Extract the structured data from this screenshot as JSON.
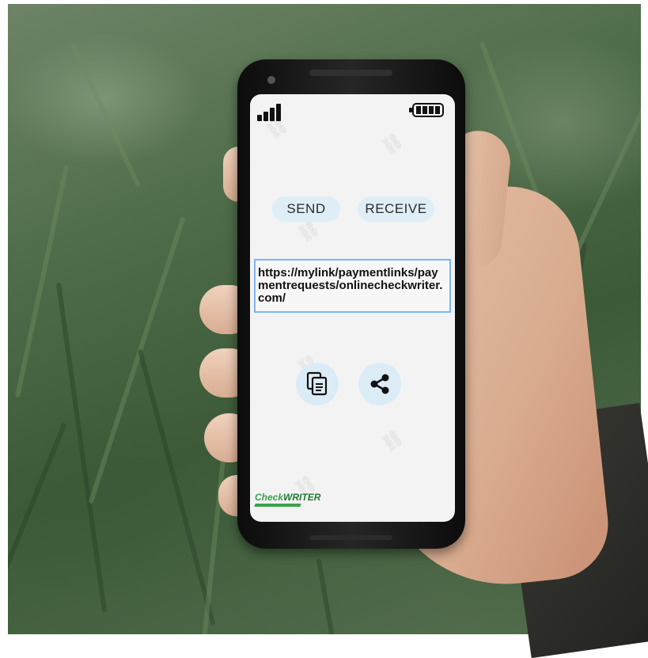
{
  "app": {
    "buttons": {
      "send_label": "SEND",
      "receive_label": "RECEIVE"
    },
    "payment_link": "https://mylink/paymentlinks/paymentrequests/onlinecheckwriter.com/",
    "actions": {
      "copy_icon": "copy-icon",
      "share_icon": "share-icon"
    },
    "status_bar": {
      "signal_icon": "signal-icon",
      "battery_icon": "battery-icon"
    },
    "logo": {
      "text_check": "Check",
      "text_writer": "WRITER"
    }
  },
  "colors": {
    "pill_bg": "#dfeef6",
    "link_border": "#7eb6f0",
    "logo_green": "#3aa34a"
  }
}
